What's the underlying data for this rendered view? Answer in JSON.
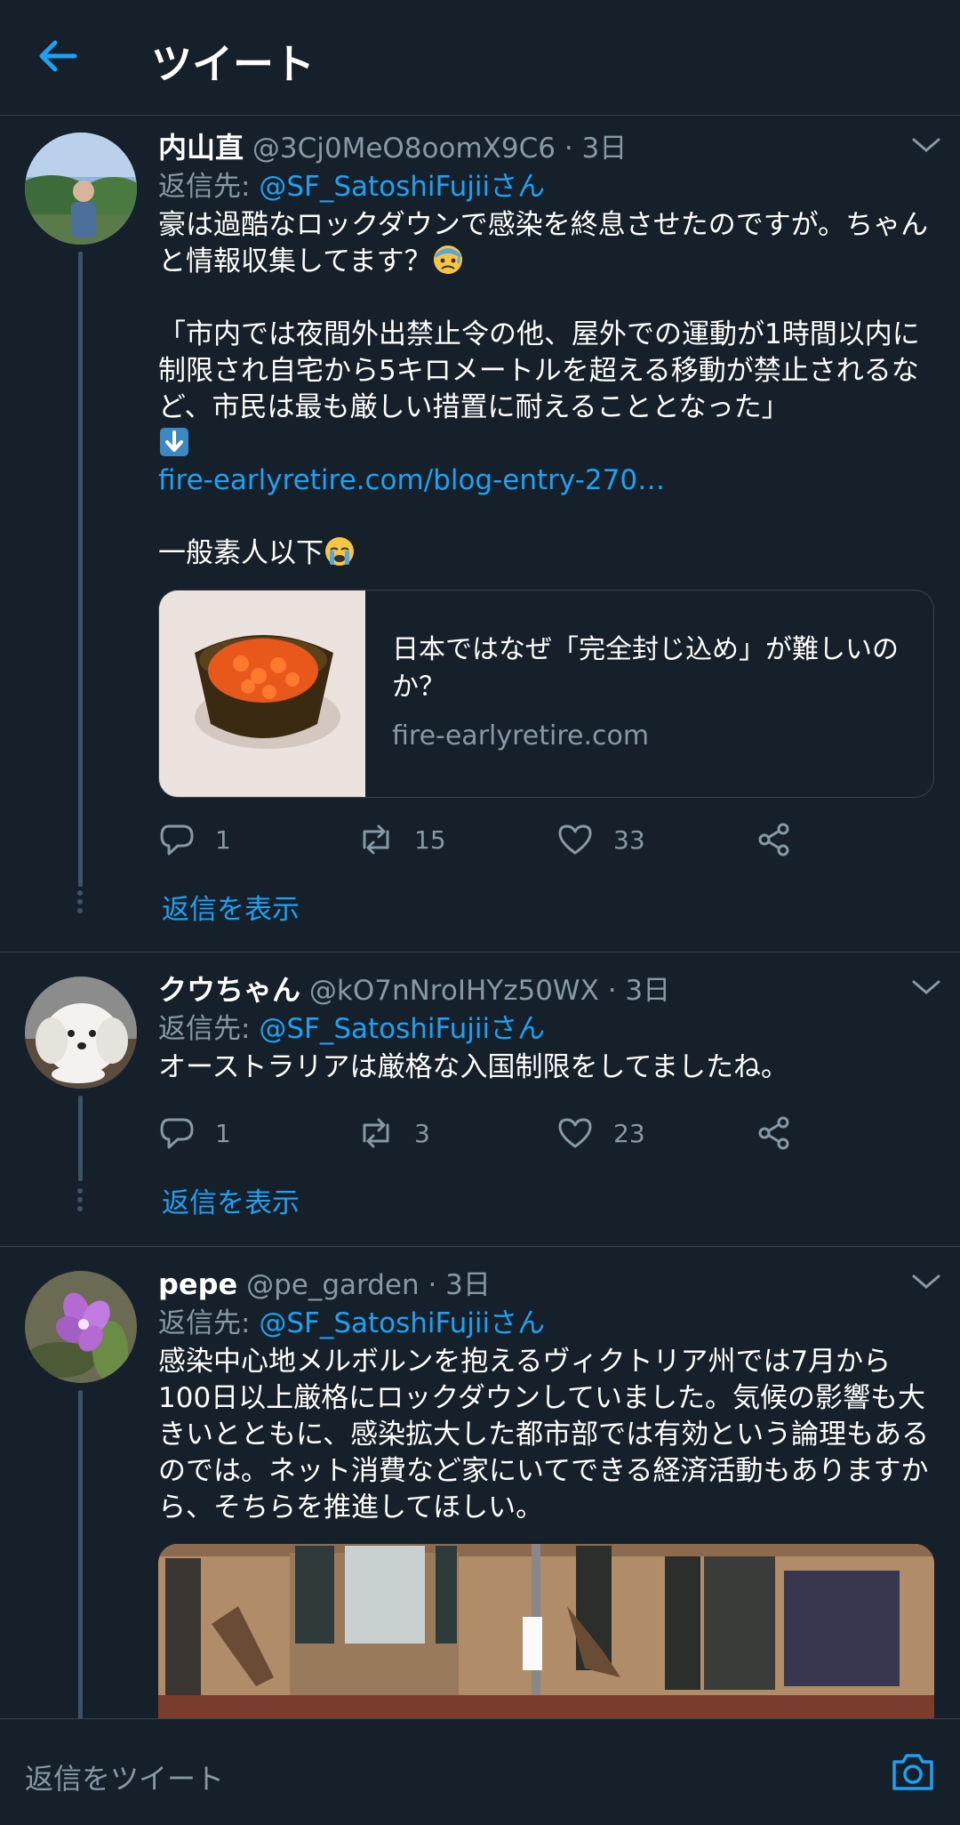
{
  "header": {
    "title": "ツイート"
  },
  "tweets": [
    {
      "name": "内山直",
      "handle": "@3Cj0MeO8oomX9C6",
      "time": "· 3日",
      "reply_label": "返信先: ",
      "reply_handle": "@SF_SatoshiFujiiさん",
      "text_1": "豪は過酷なロックダウンで感染を終息させたのですが。ちゃんと情報収集してます？",
      "text_2": "「市内では夜間外出禁止令の他、屋外での運動が1時間以内に制限され自宅から5キロメートルを超える移動が禁止されるなど、市民は最も厳しい措置に耐えることとなった」",
      "link": "fire-earlyretire.com/blog-entry-270…",
      "text_3": "一般素人以下",
      "card_title": "日本ではなぜ「完全封じ込め」が難しいのか？",
      "card_domain": "fire-earlyretire.com",
      "replies": "1",
      "retweets": "15",
      "likes": "33",
      "show_replies": "返信を表示"
    },
    {
      "name": "クウちゃん",
      "handle": "@kO7nNroIHYz50WX",
      "time": "· 3日",
      "reply_label": "返信先: ",
      "reply_handle": "@SF_SatoshiFujiiさん",
      "text": "オーストラリアは厳格な入国制限をしてましたね。",
      "replies": "1",
      "retweets": "3",
      "likes": "23",
      "show_replies": "返信を表示"
    },
    {
      "name": "pepe",
      "handle": "@pe_garden",
      "time": "· 3日",
      "reply_label": "返信先: ",
      "reply_handle": "@SF_SatoshiFujiiさん",
      "text": "感染中心地メルボルンを抱えるヴィクトリア州では7月から100日以上厳格にロックダウンしていました。気候の影響も大きいとともに、感染拡大した都市部では有効という論理もあるのでは。ネット消費など家にいてできる経済活動もありますから、そちらを推進してほしい。"
    }
  ],
  "composer": {
    "placeholder": "返信をツイート"
  },
  "colors": {
    "background": "#15202b",
    "accent": "#1da1f2",
    "muted": "#8899a6",
    "border": "#38444d"
  }
}
